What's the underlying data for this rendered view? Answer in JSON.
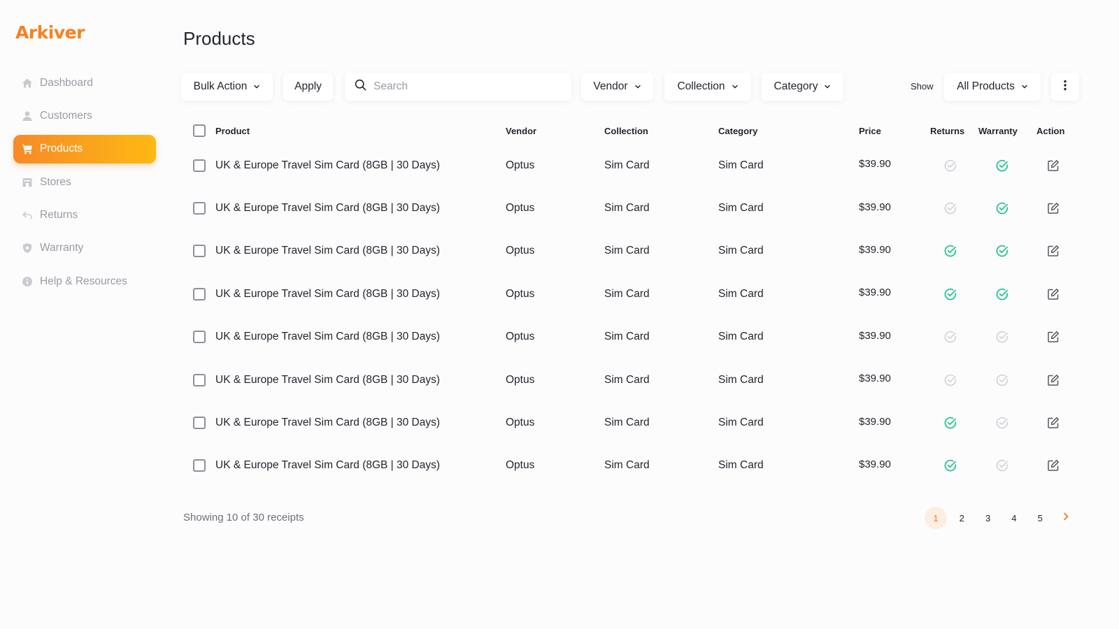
{
  "app": {
    "logo": "Arkiver",
    "brand_color": "#f58220",
    "accent_gradient": [
      "#f78a27",
      "#fdb913"
    ]
  },
  "sidebar": {
    "items": [
      {
        "label": "Dashboard",
        "icon": "home-icon",
        "active": false
      },
      {
        "label": "Customers",
        "icon": "user-icon",
        "active": false
      },
      {
        "label": "Products",
        "icon": "cart-icon",
        "active": true
      },
      {
        "label": "Stores",
        "icon": "store-icon",
        "active": false
      },
      {
        "label": "Returns",
        "icon": "return-arrow-icon",
        "active": false
      },
      {
        "label": "Warranty",
        "icon": "shield-icon",
        "active": false
      },
      {
        "label": "Help & Resources",
        "icon": "info-icon",
        "active": false
      }
    ]
  },
  "header": {
    "title": "Products"
  },
  "toolbar": {
    "bulk_action": "Bulk Action",
    "apply": "Apply",
    "search_placeholder": "Search",
    "search_value": "",
    "vendor": "Vendor",
    "collection": "Collection",
    "category": "Category",
    "show_label": "Show",
    "show_value": "All Products"
  },
  "table": {
    "headers": {
      "product": "Product",
      "vendor": "Vendor",
      "collection": "Collection",
      "category": "Category",
      "price": "Price",
      "returns": "Returns",
      "warranty": "Warranty",
      "action": "Action"
    },
    "rows": [
      {
        "product": "UK & Europe Travel Sim Card (8GB | 30 Days)",
        "vendor": "Optus",
        "collection": "Sim Card",
        "category": "Sim Card",
        "price": "$39.90",
        "returns": false,
        "warranty": true
      },
      {
        "product": "UK & Europe Travel Sim Card (8GB | 30 Days)",
        "vendor": "Optus",
        "collection": "Sim Card",
        "category": "Sim Card",
        "price": "$39.90",
        "returns": false,
        "warranty": true
      },
      {
        "product": "UK & Europe Travel Sim Card (8GB | 30 Days)",
        "vendor": "Optus",
        "collection": "Sim Card",
        "category": "Sim Card",
        "price": "$39.90",
        "returns": true,
        "warranty": true
      },
      {
        "product": "UK & Europe Travel Sim Card (8GB | 30 Days)",
        "vendor": "Optus",
        "collection": "Sim Card",
        "category": "Sim Card",
        "price": "$39.90",
        "returns": true,
        "warranty": true
      },
      {
        "product": "UK & Europe Travel Sim Card (8GB | 30 Days)",
        "vendor": "Optus",
        "collection": "Sim Card",
        "category": "Sim Card",
        "price": "$39.90",
        "returns": false,
        "warranty": false
      },
      {
        "product": "UK & Europe Travel Sim Card (8GB | 30 Days)",
        "vendor": "Optus",
        "collection": "Sim Card",
        "category": "Sim Card",
        "price": "$39.90",
        "returns": false,
        "warranty": false
      },
      {
        "product": "UK & Europe Travel Sim Card (8GB | 30 Days)",
        "vendor": "Optus",
        "collection": "Sim Card",
        "category": "Sim Card",
        "price": "$39.90",
        "returns": true,
        "warranty": false
      },
      {
        "product": "UK & Europe Travel Sim Card (8GB | 30 Days)",
        "vendor": "Optus",
        "collection": "Sim Card",
        "category": "Sim Card",
        "price": "$39.90",
        "returns": true,
        "warranty": false
      }
    ]
  },
  "footer": {
    "showing": "Showing 10 of 30 receipts",
    "pages": [
      "1",
      "2",
      "3",
      "4",
      "5"
    ],
    "current_page": "1"
  },
  "colors": {
    "check_on": "#2cc28f",
    "check_off": "#d3d5da",
    "page_active_bg": "#fdeee2",
    "page_active_text": "#f07c1c"
  }
}
